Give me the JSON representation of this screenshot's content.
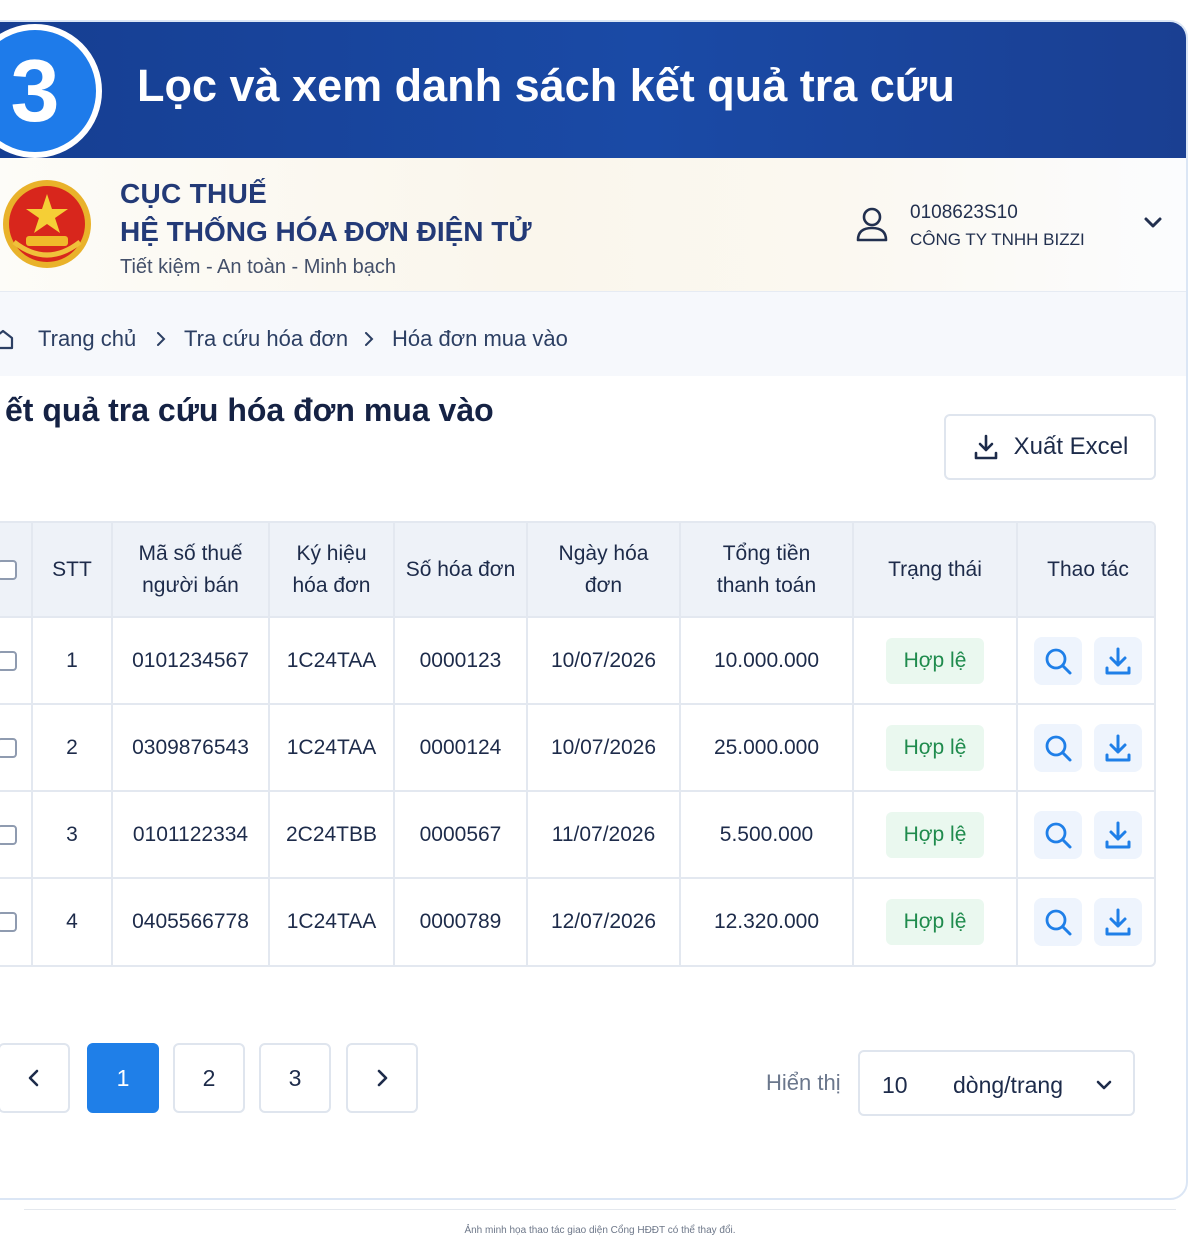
{
  "banner": {
    "step_number": "3",
    "title": "Lọc và xem danh sách kết quả tra cứu"
  },
  "header": {
    "agency": "CỤC THUẾ",
    "system": "HỆ THỐNG HÓA ĐƠN ĐIỆN TỬ",
    "slogan": "Tiết kiệm - An toàn - Minh bạch",
    "user": {
      "tax_id": "0108623S10",
      "company": "CÔNG TY TNHH BIZZI"
    }
  },
  "breadcrumb": [
    "Trang chủ",
    "Tra cứu hóa đơn",
    "Hóa đơn mua vào"
  ],
  "page_title": "ết quả tra cứu hóa đơn mua vào",
  "export_label": "Xuất Excel",
  "table": {
    "headers": {
      "stt": "STT",
      "seller_tax_line1": "Mã số thuế",
      "seller_tax_line2": "người bán",
      "symbol_line1": "Ký hiệu",
      "symbol_line2": "hóa đơn",
      "invoice_no": "Số hóa đơn",
      "date_line1": "Ngày hóa",
      "date_line2": "đơn",
      "total_line1": "Tổng tiền",
      "total_line2": "thanh toán",
      "status": "Trạng thái",
      "actions": "Thao tác"
    },
    "rows": [
      {
        "stt": "1",
        "seller_tax": "0101234567",
        "symbol": "1C24TAA",
        "invoice_no": "0000123",
        "date": "10/07/2026",
        "total": "10.000.000",
        "status": "Hợp lệ"
      },
      {
        "stt": "2",
        "seller_tax": "0309876543",
        "symbol": "1C24TAA",
        "invoice_no": "0000124",
        "date": "10/07/2026",
        "total": "25.000.000",
        "status": "Hợp lệ"
      },
      {
        "stt": "3",
        "seller_tax": "0101122334",
        "symbol": "2C24TBB",
        "invoice_no": "0000567",
        "date": "11/07/2026",
        "total": "5.500.000",
        "status": "Hợp lệ"
      },
      {
        "stt": "4",
        "seller_tax": "0405566778",
        "symbol": "1C24TAA",
        "invoice_no": "0000789",
        "date": "12/07/2026",
        "total": "12.320.000",
        "status": "Hợp lệ"
      }
    ]
  },
  "pagination": {
    "pages": [
      "1",
      "2",
      "3"
    ],
    "active": "1"
  },
  "per_page": {
    "label": "Hiển thị",
    "value": "10",
    "unit": "dòng/trang"
  },
  "caption": "Ảnh minh họa thao tác giao diện Cổng HĐĐT có thể thay đổi.",
  "icons": [
    "user-icon",
    "chevron-down-icon",
    "home-icon",
    "chevron-right-icon",
    "download-icon",
    "search-icon",
    "chevron-left-icon"
  ],
  "colors": {
    "banner": "#1a4aa6",
    "step_circle": "#1e7bea",
    "accent": "#1f7fe8",
    "status_bg": "#eaf8ef",
    "status_text": "#1f8b4d"
  }
}
